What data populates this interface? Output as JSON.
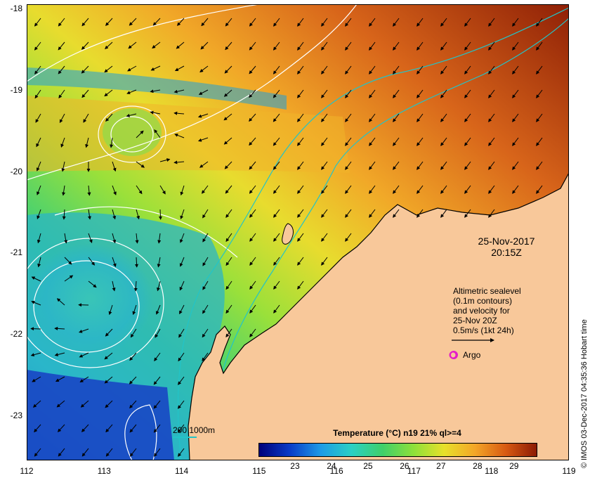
{
  "map": {
    "lat_ticks": [
      {
        "value": -18,
        "label": "-18"
      },
      {
        "value": -19,
        "label": "-19"
      },
      {
        "value": -20,
        "label": "-20"
      },
      {
        "value": -21,
        "label": "-21"
      },
      {
        "value": -22,
        "label": "-22"
      },
      {
        "value": -23,
        "label": "-23"
      }
    ],
    "lon_ticks": [
      {
        "value": 112,
        "label": "112"
      },
      {
        "value": 113,
        "label": "113"
      },
      {
        "value": 114,
        "label": "114"
      },
      {
        "value": 115,
        "label": "115"
      },
      {
        "value": 116,
        "label": "116"
      },
      {
        "value": 117,
        "label": "117"
      },
      {
        "value": 118,
        "label": "118"
      },
      {
        "value": 119,
        "label": "119"
      }
    ],
    "lon_range": [
      112,
      119
    ],
    "lat_range": [
      -23.55,
      -17.95
    ],
    "land_color": "#f8c89a",
    "coast_color": "#000000",
    "contour_color": "#ffffff",
    "isobath_color": "#22c4c8"
  },
  "overlay": {
    "date": "25-Nov-2017",
    "time": "20:15Z"
  },
  "altimetry_note": {
    "lines": [
      "Altimetric sealevel",
      "(0.1m contours)",
      "and velocity for",
      "25-Nov 20Z",
      "0.5m/s (1kt 24h)"
    ]
  },
  "argo": {
    "label": "Argo",
    "color": "#e31ec8"
  },
  "isobath_legend": {
    "label": "200  1000m"
  },
  "colorbar": {
    "title": "Temperature (°C) n19 21% ql>=4",
    "ticks": [
      {
        "value": 23,
        "label": "23"
      },
      {
        "value": 24,
        "label": "24"
      },
      {
        "value": 25,
        "label": "25"
      },
      {
        "value": 26,
        "label": "26"
      },
      {
        "value": 27,
        "label": "27"
      },
      {
        "value": 28,
        "label": "28"
      },
      {
        "value": 29,
        "label": "29"
      }
    ],
    "range": [
      22,
      29.6
    ],
    "colors": [
      "#00007a",
      "#0a3cc8",
      "#1e9be6",
      "#2bd0c4",
      "#3fcf6a",
      "#8de03a",
      "#e8e02a",
      "#f3a628",
      "#d85a12",
      "#8c1a04"
    ]
  },
  "credit": "© IMOS 03-Dec-2017 04:35:36 Hobart time"
}
